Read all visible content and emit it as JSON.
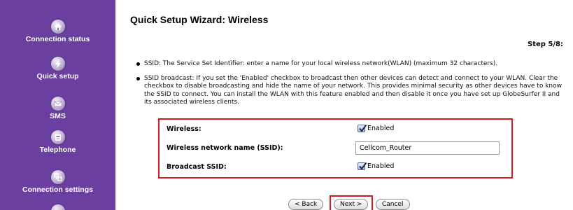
{
  "sidebar": {
    "items": [
      {
        "label": "Connection status",
        "icon": "home-icon"
      },
      {
        "label": "Quick setup",
        "icon": "lightning-icon"
      },
      {
        "label": "SMS",
        "icon": "envelope-icon"
      },
      {
        "label": "Telephone",
        "icon": "telephone-icon"
      },
      {
        "label": "Connection settings",
        "icon": "network-icon"
      }
    ],
    "background": "#6a3fa0"
  },
  "main": {
    "title": "Quick Setup Wizard: Wireless",
    "step": "Step 5/8:",
    "bullets": [
      "SSID: The Service Set Identifier: enter a name for your local wireless network(WLAN) (maximum 32 characters).",
      "SSID broadcast: If you set the 'Enabled' checkbox to broadcast then other devices can detect and connect to your WLAN. Clear the checkbox to disable broadcasting and hide the name of your network. This provides minimal security as other devices have to know the SSID to connect. You can install the WLAN with this feature enabled and then disable it once you have set up GlobeSurfer II and its associated wireless clients."
    ]
  },
  "settings": {
    "wireless_label": "Wireless:",
    "wireless_enabled_label": "Enabled",
    "wireless_enabled": true,
    "ssid_label": "Wireless network name (SSID):",
    "ssid_value": "Cellcom_Router",
    "broadcast_label": "Broadcast SSID:",
    "broadcast_enabled_label": "Enabled",
    "broadcast_enabled": true
  },
  "buttons": {
    "back": "< Back",
    "next": "Next >",
    "cancel": "Cancel"
  },
  "colors": {
    "highlight": "#d8181f",
    "sidebar": "#6a3fa0"
  }
}
